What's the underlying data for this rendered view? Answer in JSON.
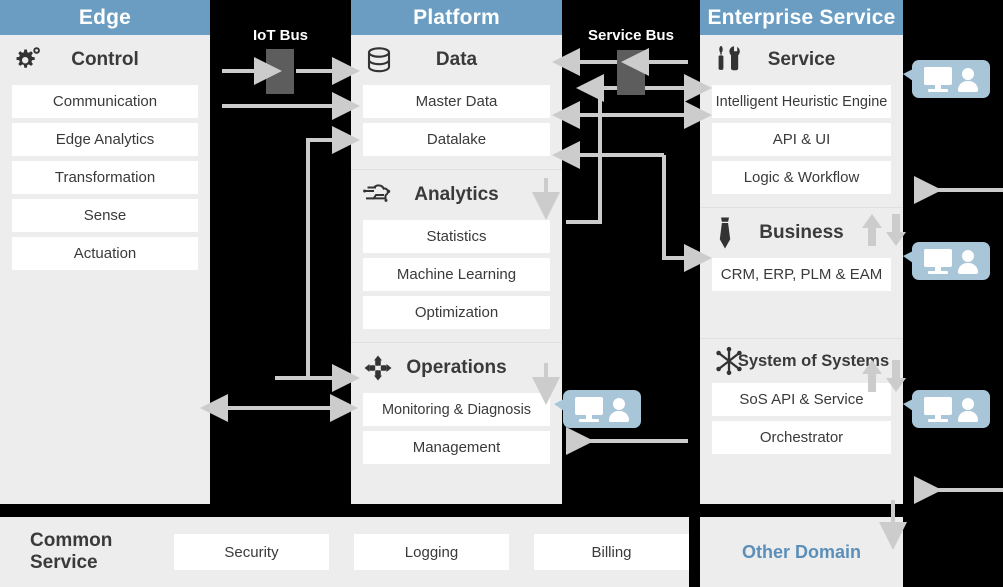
{
  "columns": [
    {
      "id": "edge",
      "title": "Edge",
      "sections": [
        {
          "icon": "gear-icon",
          "title": "Control",
          "items": [
            "Communication",
            "Edge Analytics",
            "Transformation",
            "Sense",
            "Actuation"
          ]
        }
      ]
    },
    {
      "id": "platform",
      "title": "Platform",
      "sections": [
        {
          "icon": "database-icon",
          "title": "Data",
          "items": [
            "Master Data",
            "Datalake"
          ]
        },
        {
          "icon": "analytics-brain-icon",
          "title": "Analytics",
          "items": [
            "Statistics",
            "Machine Learning",
            "Optimization"
          ]
        },
        {
          "icon": "operations-move-icon",
          "title": "Operations",
          "items": [
            "Monitoring & Diagnosis",
            "Management"
          ]
        }
      ]
    },
    {
      "id": "enterprise",
      "title": "Enterprise Service",
      "sections": [
        {
          "icon": "tools-icon",
          "title": "Service",
          "items": [
            "Intelligent Heuristic Engine",
            "API & UI",
            "Logic & Workflow"
          ]
        },
        {
          "icon": "necktie-icon",
          "title": "Business",
          "items": [
            "CRM, ERP, PLM & EAM"
          ]
        },
        {
          "icon": "network-hub-icon",
          "title": "System of Systems",
          "items": [
            "SoS API & Service",
            "Orchestrator"
          ]
        }
      ]
    }
  ],
  "buses": [
    {
      "id": "iot-bus",
      "label": "IoT Bus"
    },
    {
      "id": "service-bus",
      "label": "Service Bus"
    }
  ],
  "common_service": {
    "label": "Common Service",
    "items": [
      "Security",
      "Logging",
      "Billing"
    ]
  },
  "other_domain": {
    "label": "Other Domain"
  },
  "colors": {
    "header": "#6b9dc2",
    "panel": "#ededed",
    "item": "#ffffff",
    "bus_background": "#000000",
    "bus_box": "#5d5d5d",
    "arrow": "#cccccc",
    "badge": "#a9c6d8",
    "other_domain_text": "#5b8fb9",
    "text": "#3a3a3a"
  }
}
